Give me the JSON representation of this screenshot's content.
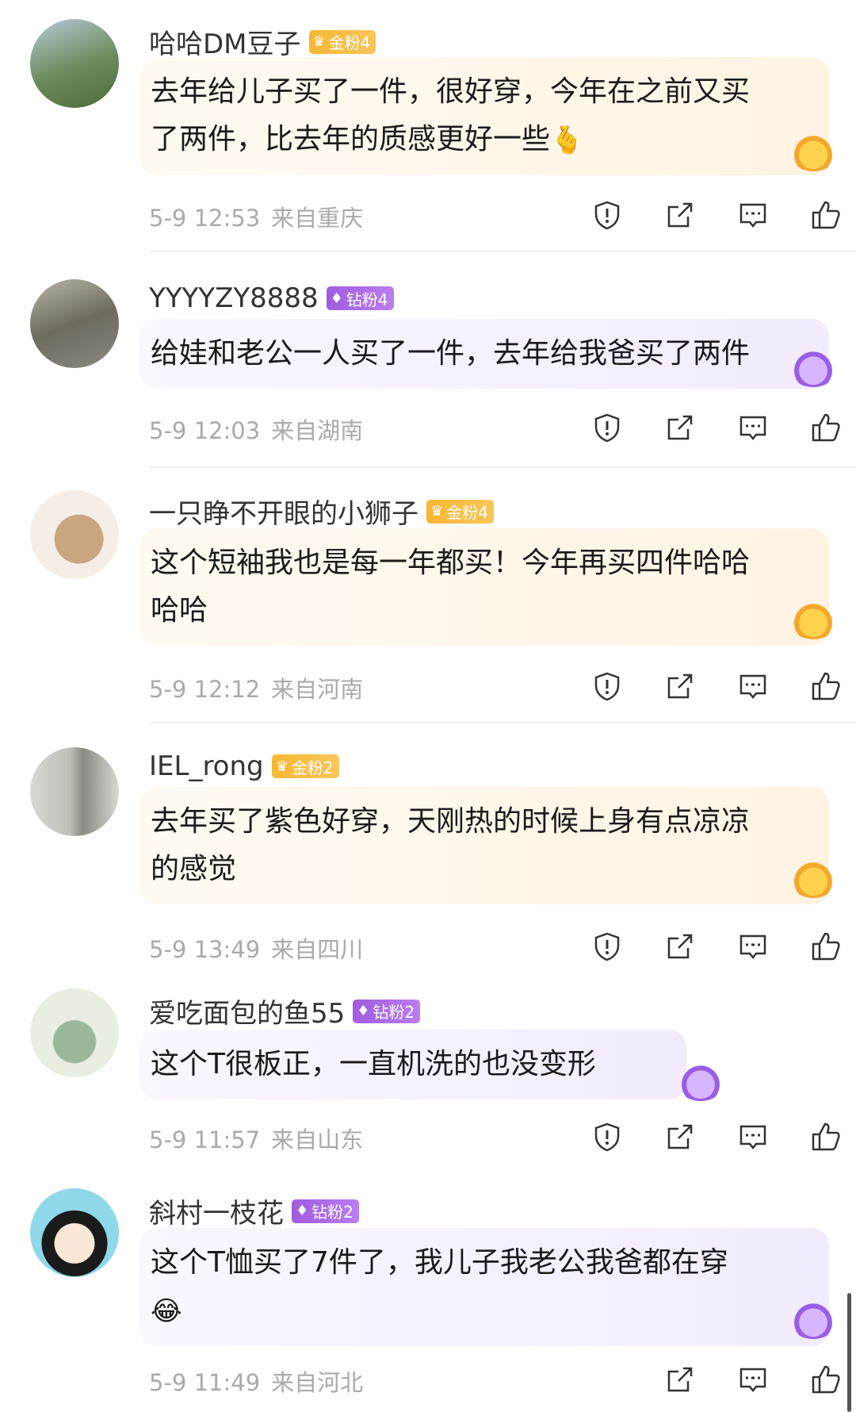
{
  "comments": [
    {
      "username": "哈哈DM豆子",
      "badge": {
        "type": "gold",
        "label": "金粉4"
      },
      "text_line1": "去年给儿子买了一件，很好穿，今年在之前又买",
      "text_line2": "了两件，比去年的质感更好一些",
      "emoji": "🫰",
      "date": "5-9 12:53",
      "location": "来自重庆",
      "avatar_colors": [
        "#6b8a5a",
        "#b7c9d8"
      ]
    },
    {
      "username": "YYYYZY8888",
      "badge": {
        "type": "diamond",
        "label": "钻粉4"
      },
      "text_line1": "给娃和老公一人买了一件，去年给我爸买了两件",
      "text_line2": "",
      "emoji": "",
      "date": "5-9 12:03",
      "location": "来自湖南",
      "avatar_colors": [
        "#6e6a5e",
        "#b8b6aa"
      ]
    },
    {
      "username": "一只睁不开眼的小狮子",
      "badge": {
        "type": "gold",
        "label": "金粉4"
      },
      "text_line1": "这个短袖我也是每一年都买！今年再买四件哈哈",
      "text_line2": "哈哈",
      "emoji": "",
      "date": "5-9 12:12",
      "location": "来自河南",
      "avatar_colors": [
        "#c9a580",
        "#f4eee6"
      ]
    },
    {
      "username": "IEL_rong",
      "badge": {
        "type": "gold",
        "label": "金粉2"
      },
      "text_line1": "去年买了紫色好穿，天刚热的时候上身有点凉凉",
      "text_line2": "的感觉",
      "emoji": "",
      "date": "5-9 13:49",
      "location": "来自四川",
      "avatar_colors": [
        "#8a8a84",
        "#d9d9d4"
      ]
    },
    {
      "username": "爱吃面包的鱼55",
      "badge": {
        "type": "diamond",
        "label": "钻粉2"
      },
      "text_line1": "这个T很板正，一直机洗的也没变形",
      "text_line2": "",
      "emoji": "",
      "date": "5-9 11:57",
      "location": "来自山东",
      "avatar_colors": [
        "#9bb79b",
        "#e9eee3"
      ]
    },
    {
      "username": "斜村一枝花",
      "badge": {
        "type": "diamond",
        "label": "钻粉2"
      },
      "text_line1": "这个T恤买了7件了，我儿子我老公我爸都在穿",
      "text_line2": "",
      "emoji": "😂",
      "date": "5-9 11:49",
      "location": "来自河北",
      "avatar_colors": [
        "#2fb6d6",
        "#8fd8ea"
      ]
    }
  ]
}
